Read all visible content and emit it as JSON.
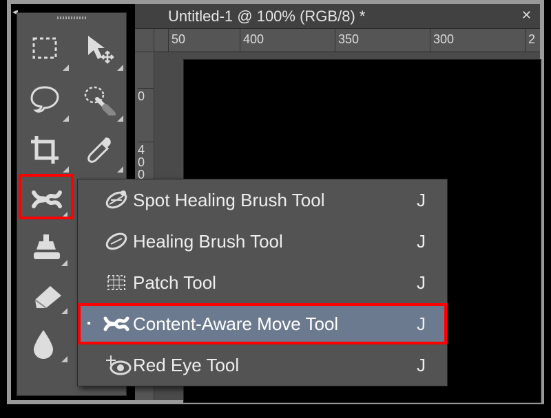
{
  "document": {
    "title": "Untitled-1 @ 100% (RGB/8) *"
  },
  "ruler": {
    "h": [
      "50",
      "400",
      "350",
      "300",
      "2"
    ],
    "v": [
      "0",
      "400"
    ]
  },
  "tools": {
    "marquee": "Rectangular Marquee",
    "move": "Move",
    "lasso": "Lasso",
    "quicksel": "Quick Selection",
    "crop": "Crop",
    "eyedrop": "Eyedropper",
    "heal": "Content-Aware Move",
    "stamp": "Clone Stamp",
    "eraser": "Eraser",
    "blur": "Blur"
  },
  "flyout": {
    "items": [
      {
        "label": "Spot Healing Brush Tool",
        "key": "J",
        "selected": false
      },
      {
        "label": "Healing Brush Tool",
        "key": "J",
        "selected": false
      },
      {
        "label": "Patch Tool",
        "key": "J",
        "selected": false
      },
      {
        "label": "Content-Aware Move Tool",
        "key": "J",
        "selected": true
      },
      {
        "label": "Red Eye Tool",
        "key": "J",
        "selected": false
      }
    ]
  }
}
